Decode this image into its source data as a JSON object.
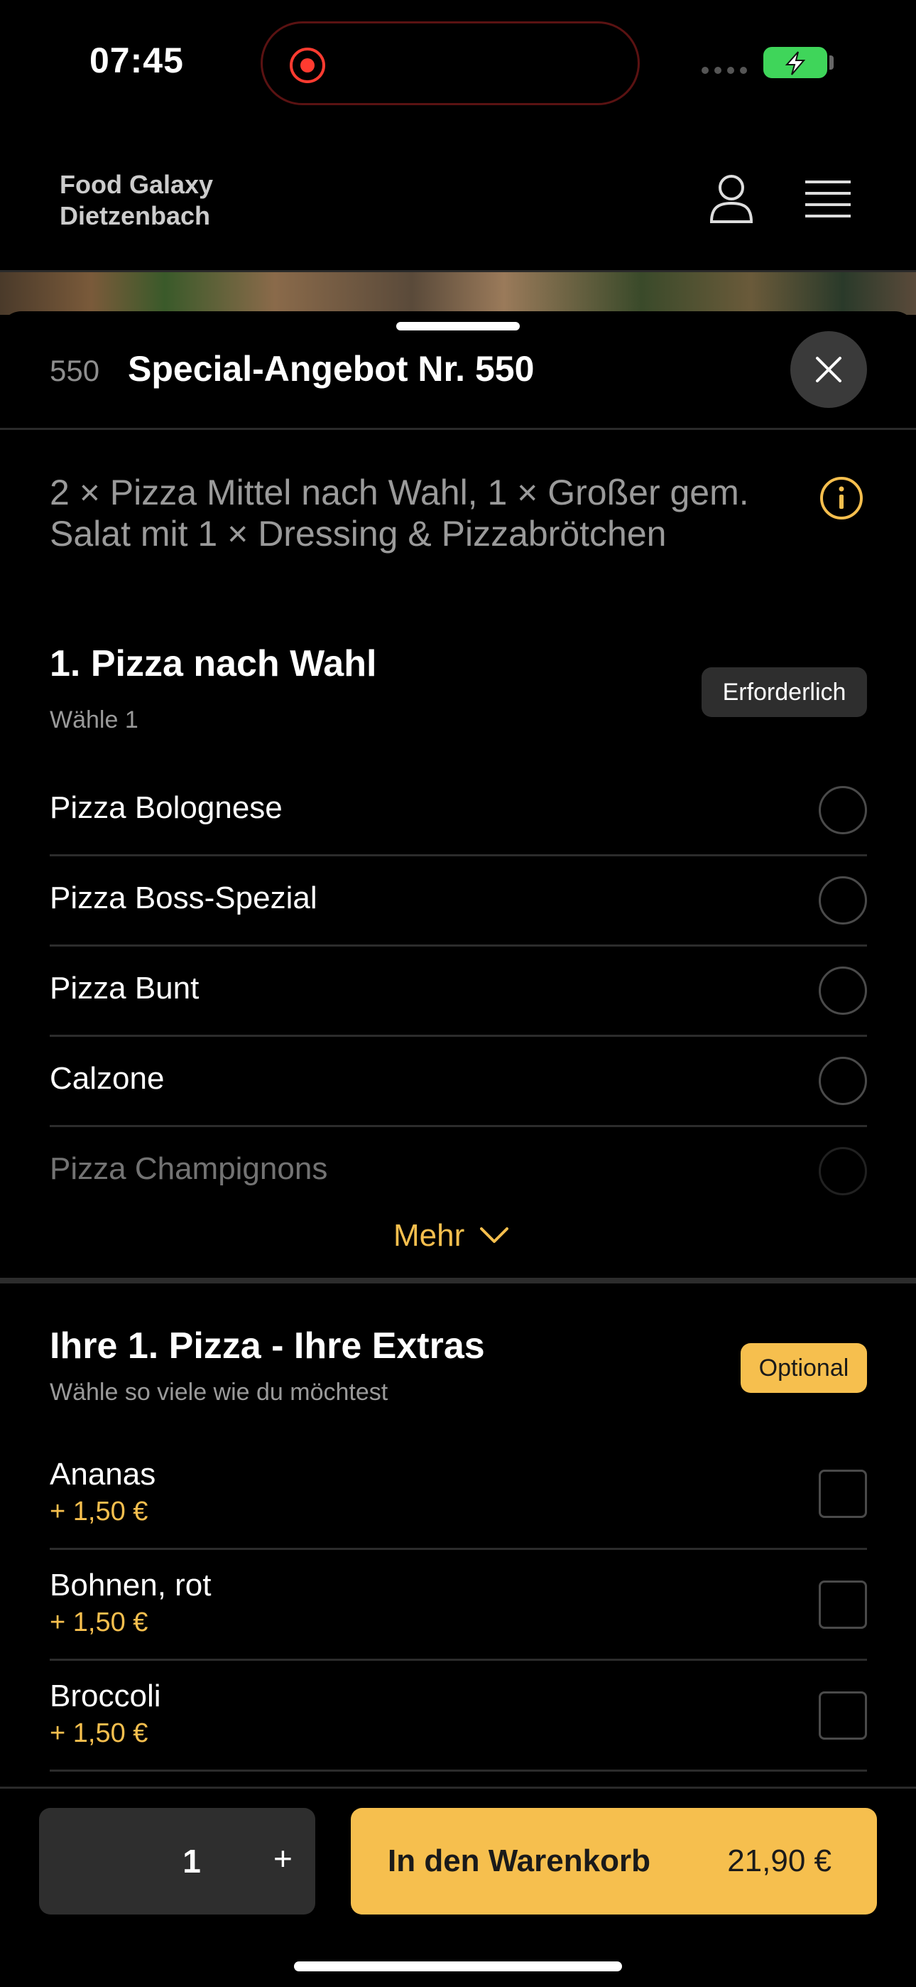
{
  "status_bar": {
    "time": "07:45"
  },
  "header": {
    "brand_line1": "Food Galaxy",
    "brand_line2": "Dietzenbach"
  },
  "item": {
    "number": "550",
    "title": "Special-Angebot Nr. 550",
    "description": "2 × Pizza Mittel nach Wahl, 1 × Großer gem. Salat mit 1 × Dressing & Pizzabrötchen"
  },
  "section1": {
    "title": "1. Pizza nach Wahl",
    "subtitle": "Wähle 1",
    "badge": "Erforderlich",
    "options": [
      "Pizza Bolognese",
      "Pizza Boss-Spezial",
      "Pizza Bunt",
      "Calzone",
      "Pizza Champignons"
    ],
    "more_label": "Mehr"
  },
  "section2": {
    "title": "Ihre 1. Pizza - Ihre Extras",
    "subtitle": "Wähle so viele wie du möchtest",
    "badge": "Optional",
    "options": [
      {
        "label": "Ananas",
        "price": "+ 1,50 €"
      },
      {
        "label": "Bohnen, rot",
        "price": "+ 1,50 €"
      },
      {
        "label": "Broccoli",
        "price": "+ 1,50 €"
      }
    ]
  },
  "bottom": {
    "quantity": "1",
    "plus": "+",
    "cart_label": "In den Warenkorb",
    "cart_price": "21,90 €"
  },
  "colors": {
    "accent": "#f6bf4e",
    "background": "#000000",
    "surface": "#2e2e2e"
  }
}
